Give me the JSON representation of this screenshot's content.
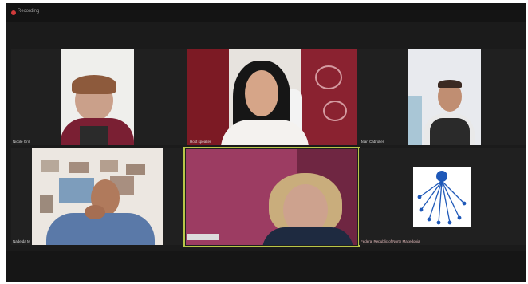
{
  "window": {
    "recording_label": "Recording"
  },
  "participants": [
    {
      "name": "Nicole Grill"
    },
    {
      "name": "Host speaker"
    },
    {
      "name": "Jean Cabrolier"
    },
    {
      "name": "Nadejda M"
    },
    {
      "name": ""
    },
    {
      "name": "Federal Republic of North Macedonia"
    }
  ],
  "colors": {
    "active_speaker": "#b9c648",
    "logo_blue": "#1e58b8"
  }
}
